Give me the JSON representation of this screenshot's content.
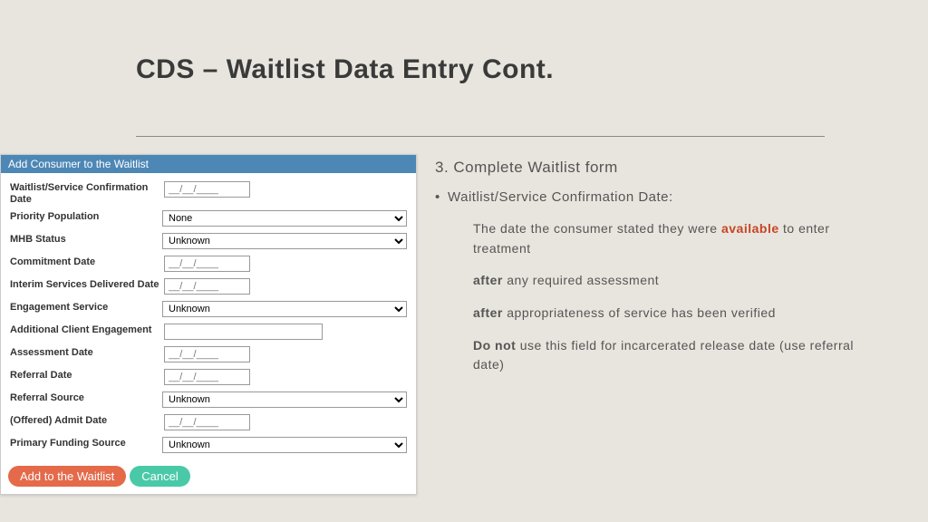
{
  "title": "CDS – Waitlist Data Entry Cont.",
  "panel": {
    "header": "Add Consumer to the Waitlist",
    "datePlaceholder": "__/__/____",
    "fields": {
      "confirmDate": "Waitlist/Service Confirmation Date",
      "priority": "Priority Population",
      "mhb": "MHB Status",
      "commitDate": "Commitment Date",
      "interimDate": "Interim Services Delivered Date",
      "engagement": "Engagement Service",
      "additional": "Additional Client Engagement",
      "assessDate": "Assessment Date",
      "referDate": "Referral Date",
      "referSrc": "Referral Source",
      "admitDate": "(Offered) Admit Date",
      "funding": "Primary Funding Source"
    },
    "options": {
      "none": "None",
      "unknown": "Unknown"
    },
    "buttons": {
      "add": "Add to the Waitlist",
      "cancel": "Cancel"
    }
  },
  "notes": {
    "step": "3. Complete Waitlist form",
    "bullet": "Waitlist/Service Confirmation Date:",
    "line1a": "The date the consumer stated they were ",
    "line1b": "available",
    "line1c": " to enter treatment",
    "line2a": "after",
    "line2b": " any required assessment",
    "line3a": "after",
    "line3b": " appropriateness of service has been verified",
    "line4a": "Do not",
    "line4b": " use this field for incarcerated release date (use referral date)"
  }
}
